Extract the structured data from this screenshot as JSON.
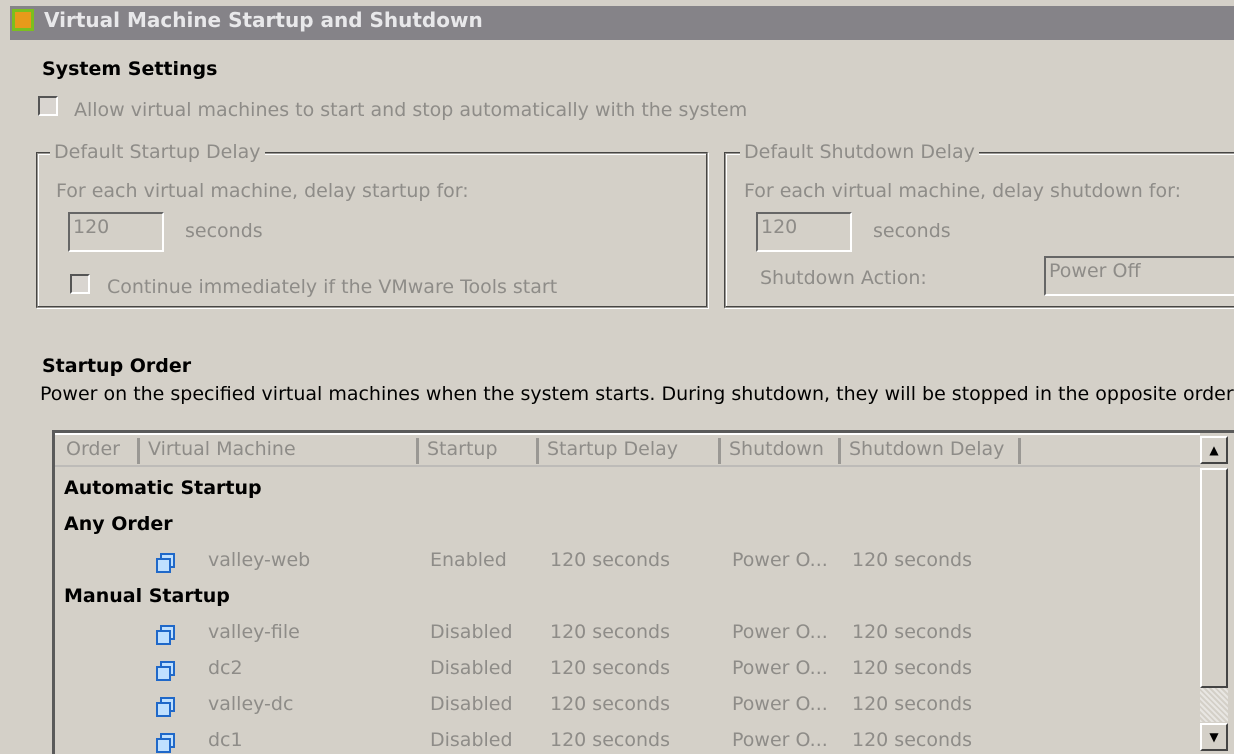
{
  "title": "Virtual Machine Startup and Shutdown",
  "system_settings": {
    "heading": "System Settings",
    "allow_auto_label": "Allow virtual machines to start and stop automatically with the system",
    "allow_auto_checked": false
  },
  "startup_delay": {
    "legend": "Default Startup Delay",
    "desc": "For each virtual machine, delay startup for:",
    "value": "120",
    "unit": "seconds",
    "continue_label": "Continue immediately if the VMware Tools start",
    "continue_checked": false
  },
  "shutdown_delay": {
    "legend": "Default Shutdown Delay",
    "desc": "For each virtual machine, delay shutdown for:",
    "value": "120",
    "unit": "seconds",
    "action_label": "Shutdown Action:",
    "action_value": "Power Off"
  },
  "startup_order": {
    "heading": "Startup Order",
    "desc": "Power on the specified virtual machines when the system starts. During shutdown, they will be stopped in the opposite order",
    "columns": [
      "Order",
      "Virtual Machine",
      "Startup",
      "Startup Delay",
      "Shutdown",
      "Shutdown Delay"
    ],
    "groups": {
      "automatic": "Automatic Startup",
      "any_order": "Any Order",
      "manual": "Manual Startup"
    },
    "rows": [
      {
        "vm": "valley-web",
        "startup": "Enabled",
        "startup_delay": "120 seconds",
        "shutdown": "Power O...",
        "shutdown_delay": "120 seconds"
      },
      {
        "vm": "valley-file",
        "startup": "Disabled",
        "startup_delay": "120 seconds",
        "shutdown": "Power O...",
        "shutdown_delay": "120 seconds"
      },
      {
        "vm": "dc2",
        "startup": "Disabled",
        "startup_delay": "120 seconds",
        "shutdown": "Power O...",
        "shutdown_delay": "120 seconds"
      },
      {
        "vm": "valley-dc",
        "startup": "Disabled",
        "startup_delay": "120 seconds",
        "shutdown": "Power O...",
        "shutdown_delay": "120 seconds"
      },
      {
        "vm": "dc1",
        "startup": "Disabled",
        "startup_delay": "120 seconds",
        "shutdown": "Power O...",
        "shutdown_delay": "120 seconds"
      }
    ]
  },
  "colors": {
    "titlebar": "#858388",
    "background": "#d4d0c8",
    "vm_icon": "#1f68c9",
    "app_icon": "#7cbf1e"
  }
}
